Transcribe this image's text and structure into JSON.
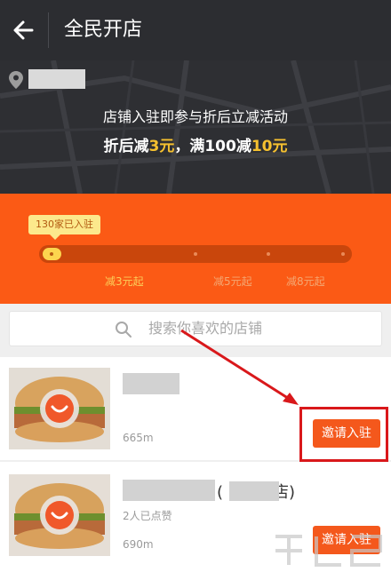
{
  "header": {
    "title": "全民开店",
    "back_icon": "back-arrow-icon"
  },
  "promo": {
    "line1": "店铺入驻即参与折后立减活动",
    "line2_prefix": "折后减",
    "line2_value1": "3元",
    "line2_mid": "，满100减",
    "line2_value2": "10元"
  },
  "progress": {
    "badge": "130家已入驻",
    "level": 0.06,
    "milestones": [
      {
        "label": "减3元起",
        "active": true
      },
      {
        "label": "减5元起",
        "active": false
      },
      {
        "label": "减8元起",
        "active": false
      }
    ]
  },
  "search": {
    "placeholder": "搜索你喜欢的店铺"
  },
  "shops": [
    {
      "distance": "665m",
      "invite_label": "邀请入驻"
    },
    {
      "name_suffix": "(",
      "name_suffix2": "店)",
      "likes": "2人已点赞",
      "distance": "690m",
      "invite_label": "邀请入驻"
    }
  ],
  "colors": {
    "accent": "#fb5a15",
    "highlight": "#f6c12f",
    "button": "#f4581c",
    "annotation": "#d9181b"
  }
}
